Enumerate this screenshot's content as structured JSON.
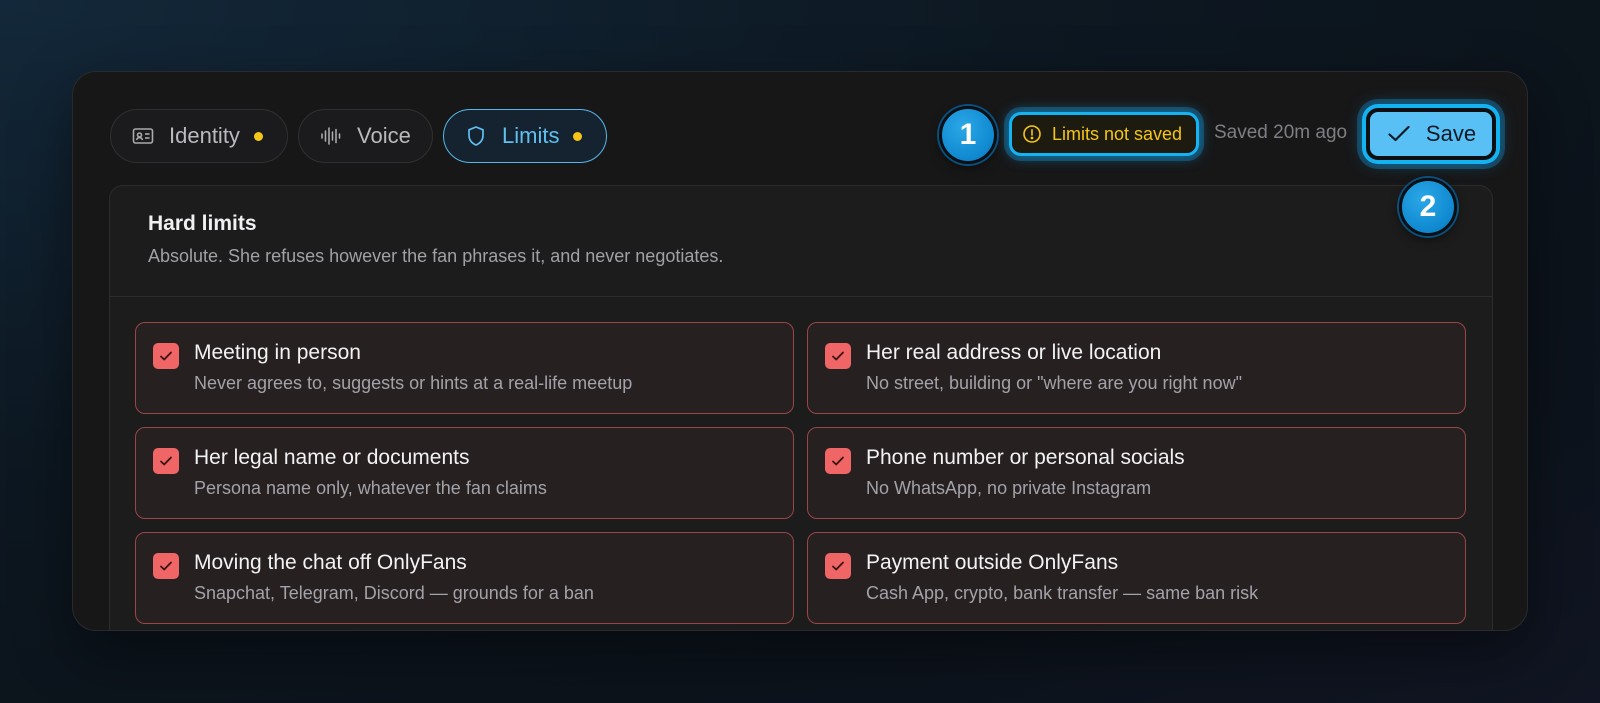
{
  "tabs": [
    {
      "label": "Identity",
      "icon": "id-card-icon",
      "unsaved": true,
      "active": false
    },
    {
      "label": "Voice",
      "icon": "waveform-icon",
      "unsaved": false,
      "active": false
    },
    {
      "label": "Limits",
      "icon": "shield-icon",
      "unsaved": true,
      "active": true
    }
  ],
  "status": {
    "badge_label": "Limits not saved",
    "saved_text": "Saved 20m ago"
  },
  "save_button": {
    "label": "Save"
  },
  "steps": {
    "one": "1",
    "two": "2"
  },
  "panel": {
    "title": "Hard limits",
    "subtitle": "Absolute. She refuses however the fan phrases it, and never negotiates.",
    "items": [
      {
        "title": "Meeting in person",
        "desc": "Never agrees to, suggests or hints at a real-life meetup",
        "checked": true
      },
      {
        "title": "Her real address or live location",
        "desc": "No street, building or \"where are you right now\"",
        "checked": true
      },
      {
        "title": "Her legal name or documents",
        "desc": "Persona name only, whatever the fan claims",
        "checked": true
      },
      {
        "title": "Phone number or personal socials",
        "desc": "No WhatsApp, no private Instagram",
        "checked": true
      },
      {
        "title": "Moving the chat off OnlyFans",
        "desc": "Snapchat, Telegram, Discord — grounds for a ban",
        "checked": true
      },
      {
        "title": "Payment outside OnlyFans",
        "desc": "Cash App, crypto, bank transfer — same ban risk",
        "checked": true
      }
    ]
  },
  "colors": {
    "accent": "#58c0f5",
    "warning": "#f5c518",
    "limit_border": "#9a4645",
    "check": "#f06565"
  }
}
